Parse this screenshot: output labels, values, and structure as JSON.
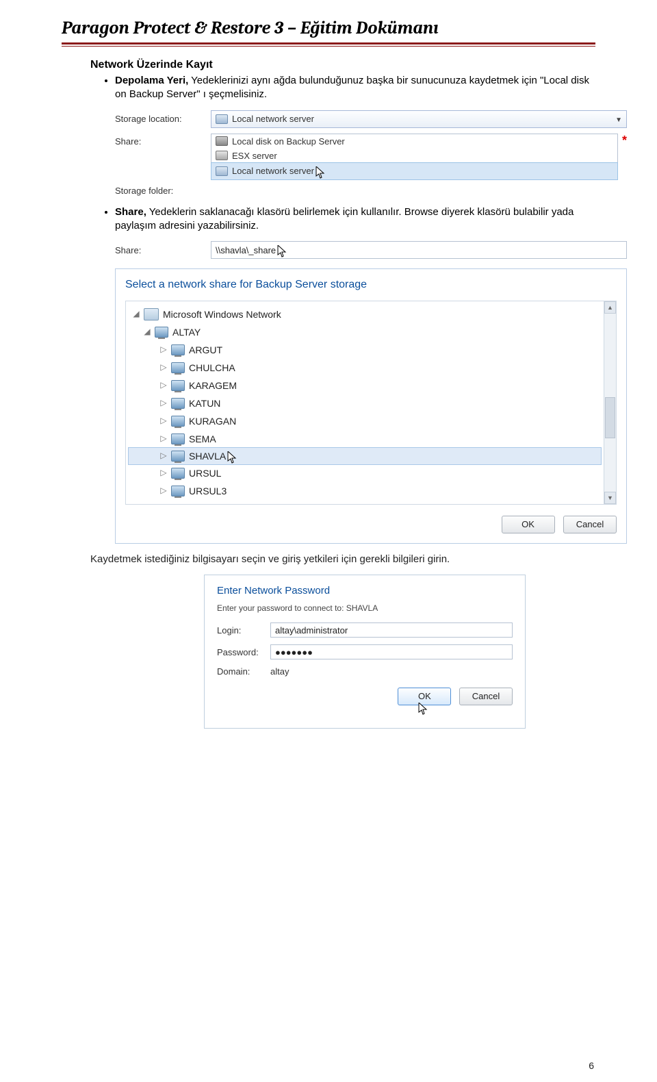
{
  "page": {
    "title": "Paragon Protect & Restore 3 – Eğitim Dokümanı",
    "number": "6"
  },
  "content": {
    "heading1": "Network Üzerinde Kayıt",
    "bullet1_bold": "Depolama Yeri,",
    "bullet1_rest": " Yedeklerinizi aynı ağda bulunduğunuz başka bir sunucunuza kaydetmek için \"Local disk on Backup Server\" ı şeçmelisiniz.",
    "bullet2_bold": "Share,",
    "bullet2_rest": " Yedeklerin saklanacağı klasörü belirlemek için kullanılır. Browse diyerek klasörü bulabilir yada paylaşım adresini yazabilirsiniz.",
    "para3": "Kaydetmek istediğiniz bilgisayarı seçin ve giriş yetkileri için gerekli bilgileri girin."
  },
  "shot1": {
    "label_storage": "Storage location:",
    "label_share": "Share:",
    "label_folder": "Storage folder:",
    "combo_value": "Local network server",
    "dd_items": [
      "Local disk on Backup Server",
      "ESX server",
      "Local network server"
    ]
  },
  "shot2": {
    "label": "Share:",
    "value": "\\\\shavla\\_share"
  },
  "shot3": {
    "title": "Select a network share for Backup Server storage",
    "root": "Microsoft Windows Network",
    "group": "ALTAY",
    "computers": [
      "ARGUT",
      "CHULCHA",
      "KARAGEM",
      "KATUN",
      "KURAGAN",
      "SEMA",
      "SHAVLA",
      "URSUL",
      "URSUL3"
    ],
    "ok": "OK",
    "cancel": "Cancel"
  },
  "shot4": {
    "title": "Enter Network Password",
    "subtitle": "Enter your password to connect to: SHAVLA",
    "login_label": "Login:",
    "login_value": "altay\\administrator",
    "pass_label": "Password:",
    "pass_value": "●●●●●●●",
    "domain_label": "Domain:",
    "domain_value": "altay",
    "ok": "OK",
    "cancel": "Cancel"
  }
}
